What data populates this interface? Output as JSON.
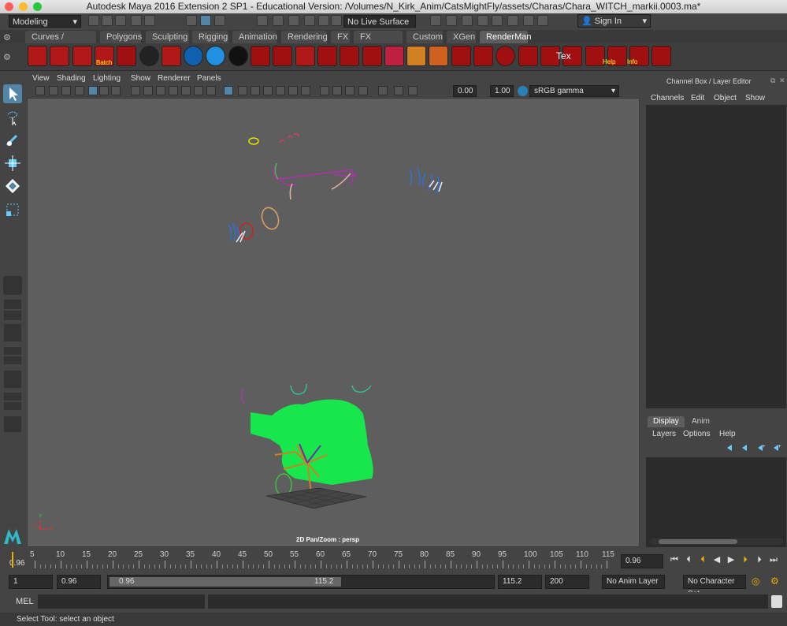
{
  "window": {
    "title": "Autodesk Maya 2016 Extension 2 SP1 - Educational Version: /Volumes/N_Kirk_Anim/CatsMightFly/assets/Charas/Chara_WITCH_markii.0003.ma*"
  },
  "status_line": {
    "menu_set": "Modeling",
    "live_surface": "No Live Surface",
    "sign_in": "Sign In"
  },
  "shelf": {
    "tabs": [
      "Curves / Surfaces",
      "Polygons",
      "Sculpting",
      "Rigging",
      "Animation",
      "Rendering",
      "FX",
      "FX Caching",
      "Custom",
      "XGen",
      "RenderMan"
    ],
    "active_tab": "RenderMan",
    "icon_labels": {
      "batch": "Batch",
      "tex": "Tex",
      "help": "Help",
      "info": "Info"
    }
  },
  "viewport": {
    "menus": [
      "View",
      "Shading",
      "Lighting",
      "Show",
      "Renderer",
      "Panels"
    ],
    "exposure": "0.00",
    "gamma": "1.00",
    "color_space": "sRGB gamma",
    "hud_label": "2D Pan/Zoom : persp"
  },
  "channel_box": {
    "title": "Channel Box / Layer Editor",
    "menus": [
      "Channels",
      "Edit",
      "Object",
      "Show"
    ]
  },
  "layer_editor": {
    "tabs": [
      "Display",
      "Anim"
    ],
    "active_tab": "Display",
    "menus": [
      "Layers",
      "Options",
      "Help"
    ]
  },
  "timeline": {
    "ticks": [
      "5",
      "10",
      "15",
      "20",
      "25",
      "30",
      "35",
      "40",
      "45",
      "50",
      "55",
      "60",
      "65",
      "70",
      "75",
      "80",
      "85",
      "90",
      "95",
      "100",
      "105",
      "110",
      "115"
    ],
    "current_frame_left": "0.96",
    "current_frame": "0.96"
  },
  "range": {
    "start": "1",
    "playback_start": "0.96",
    "slider_start": "0.96",
    "slider_end": "115.2",
    "playback_end": "115.2",
    "end": "200",
    "anim_layer": "No Anim Layer",
    "character_set": "No Character Set"
  },
  "command_line": {
    "label": "MEL"
  },
  "help_line": {
    "text": "Select Tool: select an object"
  }
}
